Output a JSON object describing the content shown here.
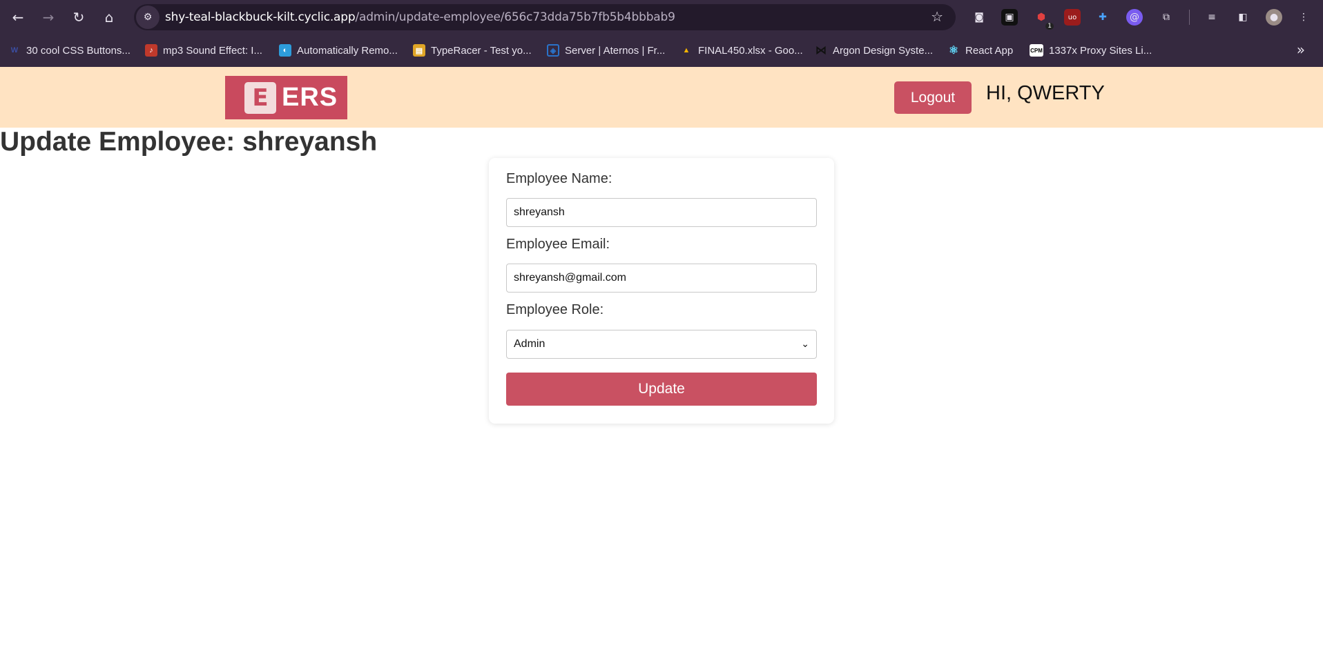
{
  "browser": {
    "url_host": "shy-teal-blackbuck-kilt.cyclic.app",
    "url_path": "/admin/update-employee/656c73dda75b7fb5b4bbbab9",
    "extension_badge": "1",
    "bookmarks": [
      {
        "label": "30 cool CSS Buttons...",
        "icon": "w-icon",
        "color": "#3b4ea3",
        "glyph": "W"
      },
      {
        "label": "mp3 Sound Effect: I...",
        "icon": "music-note-icon",
        "color": "#c0392b",
        "glyph": "♪"
      },
      {
        "label": "Automatically Remo...",
        "icon": "remove-bg-icon",
        "color": "#2d9cdb",
        "glyph": "◐"
      },
      {
        "label": "TypeRacer - Test yo...",
        "icon": "typeracer-icon",
        "color": "#e0a526",
        "glyph": "▤"
      },
      {
        "label": "Server | Aternos | Fr...",
        "icon": "aternos-icon",
        "color": "#2a72c9",
        "glyph": "◈"
      },
      {
        "label": "FINAL450.xlsx - Goo...",
        "icon": "google-drive-icon",
        "color": "#1fa463",
        "glyph": "▲"
      },
      {
        "label": "Argon Design Syste...",
        "icon": "bowtie-icon",
        "color": "#222222",
        "glyph": "⋈"
      },
      {
        "label": "React App",
        "icon": "react-icon",
        "color": "#35293f",
        "glyph": "⚛"
      },
      {
        "label": "1337x Proxy Sites Li...",
        "icon": "cpm-icon",
        "color": "#ffffff",
        "glyph": "CPM"
      }
    ]
  },
  "header": {
    "logo_text": "ERS",
    "logout_label": "Logout",
    "greeting": "HI, QWERTY"
  },
  "page": {
    "title": "Update Employee: shreyansh"
  },
  "form": {
    "name_label": "Employee Name:",
    "name_value": "shreyansh",
    "email_label": "Employee Email:",
    "email_value": "shreyansh@gmail.com",
    "role_label": "Employee Role:",
    "role_value": "Admin",
    "submit_label": "Update"
  },
  "colors": {
    "accent": "#c95162",
    "header_bg": "#ffe3c2",
    "chrome_bg": "#35293f"
  }
}
